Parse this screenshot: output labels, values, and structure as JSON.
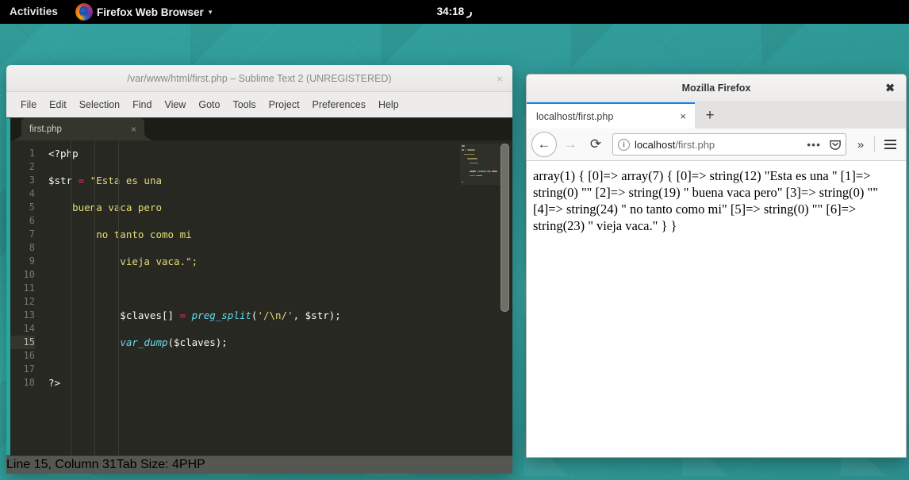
{
  "topbar": {
    "activities": "Activities",
    "app_menu": "Firefox Web Browser",
    "app_caret": "▾",
    "clock": "34:18 ر",
    "firefox_icon": "firefox-logo-icon"
  },
  "sublime": {
    "title": "/var/www/html/first.php – Sublime Text 2 (UNREGISTERED)",
    "close_label": "×",
    "menu": [
      "File",
      "Edit",
      "Selection",
      "Find",
      "View",
      "Goto",
      "Tools",
      "Project",
      "Preferences",
      "Help"
    ],
    "tab": {
      "name": "first.php",
      "close": "×"
    },
    "gutter": [
      "1",
      "2",
      "3",
      "4",
      "5",
      "6",
      "7",
      "8",
      "9",
      "10",
      "11",
      "12",
      "13",
      "14",
      "15",
      "16",
      "17",
      "18"
    ],
    "current_line": 15,
    "code": [
      {
        "n": 1,
        "segments": [
          {
            "t": "<?php",
            "c": "kw"
          }
        ]
      },
      {
        "n": 2,
        "segments": []
      },
      {
        "n": 3,
        "segments": [
          {
            "t": "$str ",
            "c": "var"
          },
          {
            "t": "=",
            "c": "op"
          },
          {
            "t": " \"Esta es una",
            "c": "str"
          }
        ]
      },
      {
        "n": 4,
        "segments": []
      },
      {
        "n": 5,
        "segments": [
          {
            "t": "    buena vaca pero",
            "c": "str"
          }
        ]
      },
      {
        "n": 6,
        "segments": []
      },
      {
        "n": 7,
        "segments": [
          {
            "t": "        no tanto como mi",
            "c": "str"
          }
        ]
      },
      {
        "n": 8,
        "segments": []
      },
      {
        "n": 9,
        "segments": [
          {
            "t": "            vieja vaca.\";",
            "c": "str"
          }
        ]
      },
      {
        "n": 10,
        "segments": []
      },
      {
        "n": 11,
        "segments": []
      },
      {
        "n": 12,
        "segments": []
      },
      {
        "n": 13,
        "segments": [
          {
            "t": "            $claves[] ",
            "c": "var"
          },
          {
            "t": "=",
            "c": "op"
          },
          {
            "t": " ",
            "c": "pun"
          },
          {
            "t": "preg_split",
            "c": "fn"
          },
          {
            "t": "(",
            "c": "pun"
          },
          {
            "t": "'/\\n/'",
            "c": "str"
          },
          {
            "t": ", $str);",
            "c": "pun"
          }
        ]
      },
      {
        "n": 14,
        "segments": []
      },
      {
        "n": 15,
        "segments": [
          {
            "t": "            ",
            "c": "pun"
          },
          {
            "t": "var_dump",
            "c": "fn"
          },
          {
            "t": "($claves);",
            "c": "pun"
          }
        ]
      },
      {
        "n": 16,
        "segments": []
      },
      {
        "n": 17,
        "segments": []
      },
      {
        "n": 18,
        "segments": [
          {
            "t": "?>",
            "c": "kw"
          }
        ]
      }
    ],
    "status": {
      "position": "Line 15, Column 31",
      "tab_size": "Tab Size: 4",
      "language": "PHP"
    }
  },
  "firefox": {
    "window_title": "Mozilla Firefox",
    "close_label": "✖",
    "tab": {
      "label": "localhost/first.php",
      "close": "×"
    },
    "new_tab": "+",
    "nav": {
      "back": "←",
      "forward": "→",
      "reload": "⟳",
      "info_icon": "i",
      "url_host": "localhost",
      "url_path": "/first.php",
      "page_actions": "•••",
      "pocket_icon": "pocket-icon",
      "overflow": "»",
      "menu_icon": "hamburger-menu-icon"
    },
    "page_content": "array(1) { [0]=> array(7) { [0]=> string(12) \"Esta es una \" [1]=> string(0) \"\" [2]=> string(19) \" buena vaca pero\" [3]=> string(0) \"\" [4]=> string(24) \" no tanto como mi\" [5]=> string(0) \"\" [6]=> string(23) \" vieja vaca.\" } }"
  },
  "colors": {
    "desktop_teal": "#2e9a97",
    "sublime_bg": "#272822",
    "sublime_accent": "#2aa6a0",
    "tab_active_blue": "#0a84ff",
    "string_yellow": "#e6db74",
    "operator_pink": "#f92672",
    "function_cyan": "#66d9ef"
  }
}
